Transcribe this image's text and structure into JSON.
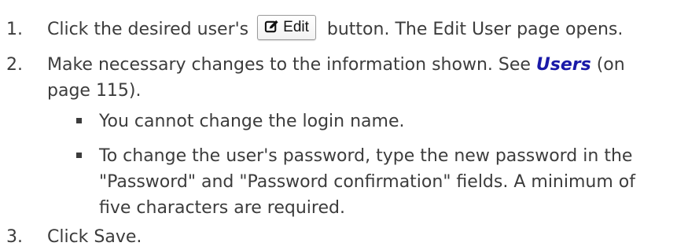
{
  "steps": [
    {
      "number": "1.",
      "before_button": "Click the desired user's",
      "button_label": "Edit",
      "button_icon": "edit-icon",
      "after_button": "button. The Edit User page opens."
    },
    {
      "number": "2.",
      "line1_text": "Make necessary changes to the information shown. See ",
      "link_text": "Users",
      "link_suffix": " (on",
      "line2_text": "page 115).",
      "bullets": [
        {
          "lines": [
            "You cannot change the login name."
          ]
        },
        {
          "lines": [
            "To change the user's password, type the new password in the",
            "\"Password\" and \"Password confirmation\" fields. A minimum of",
            "five characters are required."
          ]
        }
      ]
    },
    {
      "number": "3.",
      "text": "Click Save."
    }
  ],
  "colors": {
    "text": "#3c3c3c",
    "link": "#1a1aa8"
  }
}
